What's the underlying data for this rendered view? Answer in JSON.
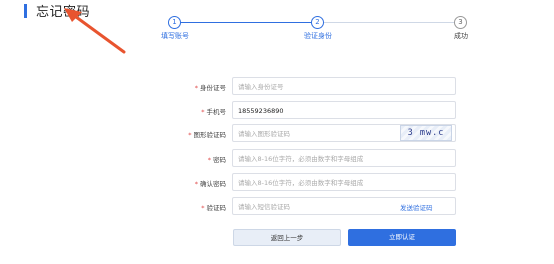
{
  "page": {
    "title": "忘记密码"
  },
  "steps": [
    {
      "number": "1",
      "label": "填写账号"
    },
    {
      "number": "2",
      "label": "验证身份"
    },
    {
      "number": "3",
      "label": "成功"
    }
  ],
  "form": {
    "id_card": {
      "label": "身份证号",
      "placeholder": "请输入身份证号"
    },
    "phone": {
      "label": "手机号",
      "value": "18559236890"
    },
    "captcha": {
      "label": "图形验证码",
      "placeholder": "请输入图形验证码",
      "image_text": "3 mw.c"
    },
    "password": {
      "label": "密码",
      "placeholder": "请输入8-16位字符，必须由数字和字母组成"
    },
    "confirm_password": {
      "label": "确认密码",
      "placeholder": "请输入8-16位字符，必须由数字和字母组成"
    },
    "sms_code": {
      "label": "验证码",
      "placeholder": "请输入短信验证码",
      "send_label": "发送验证码"
    },
    "required_mark": "*"
  },
  "buttons": {
    "back": "返回上一步",
    "submit": "立即认证"
  },
  "colors": {
    "accent": "#2f6fe0",
    "arrow": "#e8542f",
    "required": "#e04b4b"
  }
}
